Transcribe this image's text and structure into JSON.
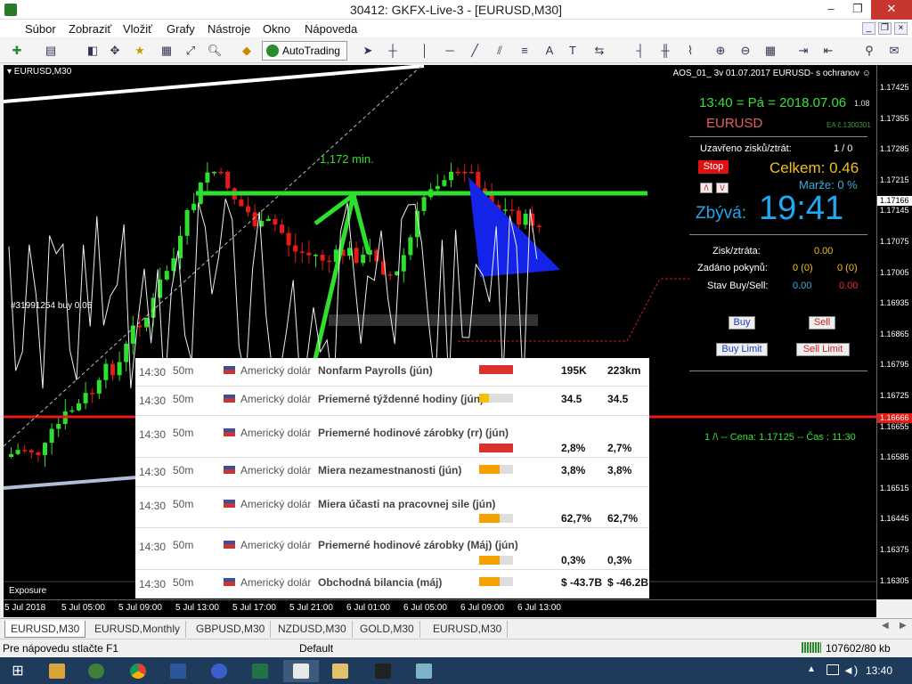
{
  "window": {
    "title": "30412: GKFX-Live-3 - [EURUSD,M30]",
    "min": "–",
    "restore": "❐",
    "close": "✕"
  },
  "menu": [
    "Súbor",
    "Zobraziť",
    "Vložiť",
    "Grafy",
    "Nástroje",
    "Okno",
    "Nápoveda"
  ],
  "toolbar": {
    "autotrading": "AutoTrading"
  },
  "chart": {
    "symbol_label": "▾ EURUSD,M30",
    "ea_label": "AOS_01_ 3v 01.07.2017 EURUSD- s ochranov",
    "min_label": "1,172 min.",
    "order_label": "#31991254 buy 0.05",
    "exposure": "Exposure",
    "time_labels": [
      "5 Jul 2018",
      "5 Jul 05:00",
      "5 Jul 09:00",
      "5 Jul 13:00",
      "5 Jul 17:00",
      "5 Jul 21:00",
      "6 Jul 01:00",
      "6 Jul 05:00",
      "6 Jul 09:00",
      "6 Jul 13:00"
    ],
    "price_labels": [
      "1.17425",
      "1.17355",
      "1.17285",
      "1.17215",
      "1.17145",
      "1.17075",
      "1.17005",
      "1.16935",
      "1.16865",
      "1.16795",
      "1.16725",
      "1.16655",
      "1.16585",
      "1.16515",
      "1.16445",
      "1.16375",
      "1.16305"
    ],
    "price_current": "1.17166",
    "price_red": "1.16666"
  },
  "panel": {
    "time_line": "13:40 = Pá = 2018.07.06",
    "version": "1.08",
    "symbol": "EURUSD",
    "ea_id": "EA č.1300301",
    "closed_label": "Uzavřeno zisků/ztrát:",
    "closed_value": "1 / 0",
    "stop": "Stop",
    "total": "Celkem: 0.46",
    "margin": "Marže:  0 %",
    "remaining_label": "Zbývá:",
    "remaining_value": "19:41",
    "pl_label": "Zisk/ztráta:",
    "pl_value": "0.00",
    "orders_label": "Zadáno pokynů:",
    "orders_buy": "0 (0)",
    "orders_sell": "0 (0)",
    "state_label": "Stav Buy/Sell:",
    "state_buy": "0.00",
    "state_sell": "0.00",
    "buy": "Buy",
    "sell": "Sell",
    "buy_limit": "Buy Limit",
    "sell_limit": "Sell Limit",
    "info_line": "1 /\\ -- Cena: 1.17125 -- Čas : 11:30"
  },
  "news": [
    {
      "time": "14:30",
      "dur": "50m",
      "currency": "Americký dolár",
      "event": "Nonfarm Payrolls (jún)",
      "impact": 1.0,
      "color": "#d9312b",
      "actual": "195K",
      "forecast": "223km"
    },
    {
      "time": "14:30",
      "dur": "50m",
      "currency": "Americký dolár",
      "event": "Priemerné týždenné hodiny (jún)",
      "impact": 0.3,
      "color": "#f2c200",
      "actual": "34.5",
      "forecast": "34.5"
    },
    {
      "time": "14:30",
      "dur": "50m",
      "currency": "Americký dolár",
      "event": "Priemerné hodinové zárobky (rr) (jún)",
      "impact": 1.0,
      "color": "#d9312b",
      "actual": "2,8%",
      "forecast": "2,7%"
    },
    {
      "time": "14:30",
      "dur": "50m",
      "currency": "Americký dolár",
      "event": "Miera nezamestnanosti (jún)",
      "impact": 0.6,
      "color": "#f5a000",
      "actual": "3,8%",
      "forecast": "3,8%"
    },
    {
      "time": "14:30",
      "dur": "50m",
      "currency": "Americký dolár",
      "event": "Miera účasti na pracovnej sile (jún)",
      "impact": 0.6,
      "color": "#f5a000",
      "actual": "62,7%",
      "forecast": "62,7%"
    },
    {
      "time": "14:30",
      "dur": "50m",
      "currency": "Americký dolár",
      "event": "Priemerné hodinové zárobky (Máj) (jún)",
      "impact": 0.6,
      "color": "#f5a000",
      "actual": "0,3%",
      "forecast": "0,3%"
    },
    {
      "time": "14:30",
      "dur": "50m",
      "currency": "Americký dolár",
      "event": "Obchodná bilancia (máj)",
      "impact": 0.6,
      "color": "#f5a000",
      "actual": "$ -43.7B",
      "forecast": "$ -46.2B"
    }
  ],
  "tabs": [
    "EURUSD,M30",
    "EURUSD,Monthly",
    "GBPUSD,M30",
    "NZDUSD,M30",
    "GOLD,M30",
    "EURUSD,M30"
  ],
  "status": {
    "help": "Pre nápovedu stlačte F1",
    "profile": "Default",
    "traffic": "107602/80 kb"
  },
  "taskbar": {
    "clock": "13:40"
  }
}
